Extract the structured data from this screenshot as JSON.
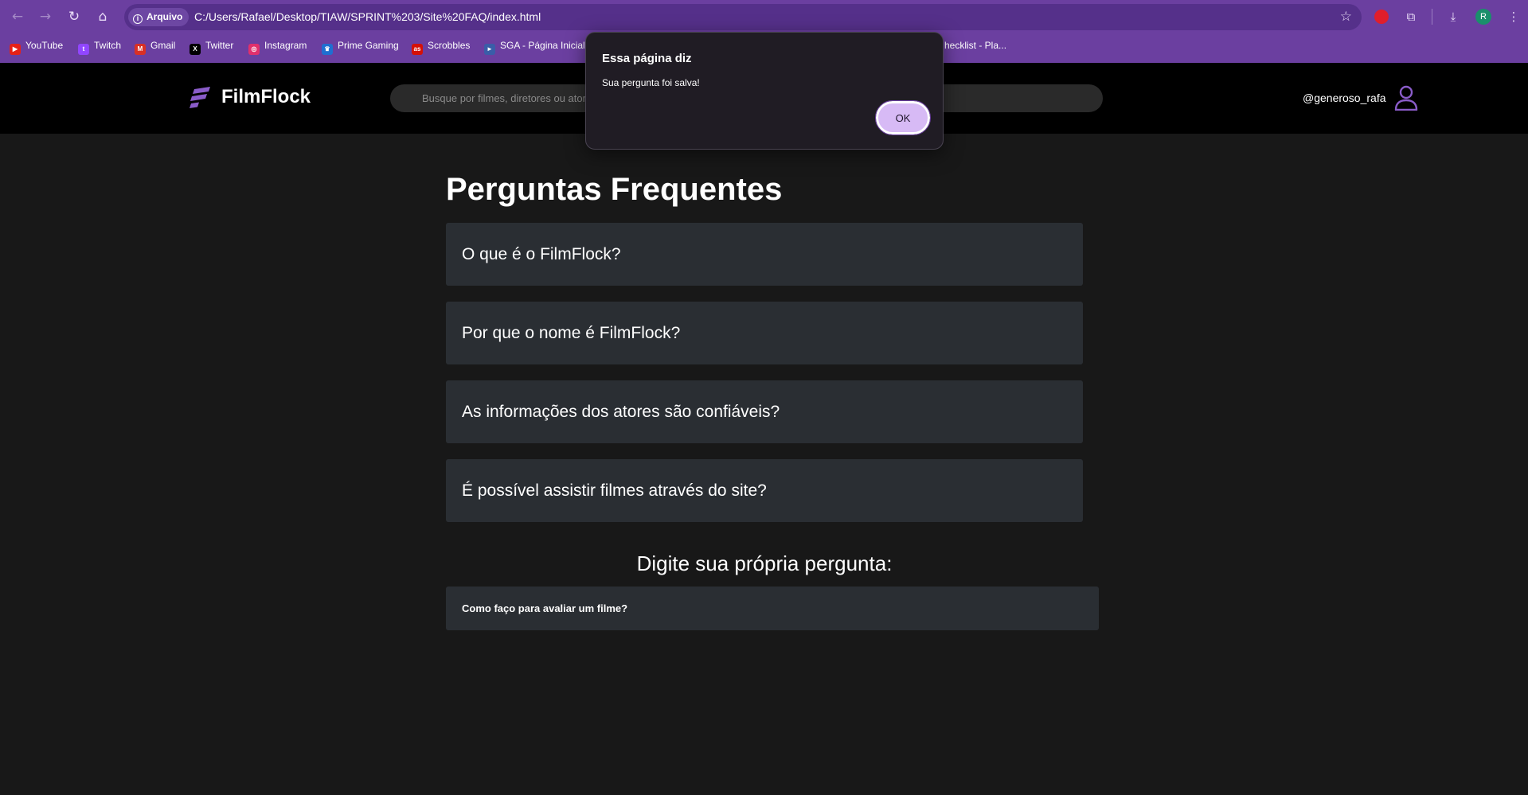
{
  "browser": {
    "nav_icons": {
      "back": "arrow-left-icon",
      "forward": "arrow-right-icon",
      "reload": "reload-icon",
      "home": "home-icon"
    },
    "security_chip": "Arquivo",
    "url": "C:/Users/Rafael/Desktop/TIAW/SPRINT%203/Site%20FAQ/index.html",
    "profile_initial": "R",
    "colors": {
      "frame": "#6b3fa0",
      "omnibox": "#55308a"
    }
  },
  "bookmarks": [
    {
      "label": "YouTube",
      "icon": "youtube-icon",
      "color": "#e62117"
    },
    {
      "label": "Twitch",
      "icon": "twitch-icon",
      "color": "#9146ff"
    },
    {
      "label": "Gmail",
      "icon": "gmail-icon",
      "color": "#d93025"
    },
    {
      "label": "Twitter",
      "icon": "x-icon",
      "color": "#000000"
    },
    {
      "label": "Instagram",
      "icon": "instagram-icon",
      "color": "#e1306c"
    },
    {
      "label": "Prime Gaming",
      "icon": "crown-icon",
      "color": "#1f6fd1"
    },
    {
      "label": "Scrobbles",
      "icon": "lastfm-icon",
      "color": "#d51007"
    },
    {
      "label": "SGA - Página Inicial",
      "icon": "sga-icon",
      "color": "#3a5da8"
    },
    {
      "label": "hecklist - Pla...",
      "icon": "",
      "color": ""
    }
  ],
  "site": {
    "brand": "FilmFlock",
    "search_placeholder": "Busque por filmes, diretores ou atores...",
    "username": "@generoso_rafa",
    "accent": "#8a5cc9"
  },
  "faq": {
    "title": "Perguntas Frequentes",
    "items": [
      "O que é o FilmFlock?",
      "Por que o nome é FilmFlock?",
      "As informações dos atores são confiáveis?",
      "É possível assistir filmes através do site?"
    ],
    "ask_title": "Digite sua própria pergunta:",
    "ask_value": "Como faço para avaliar um filme?"
  },
  "dialog": {
    "title": "Essa página diz",
    "message": "Sua pergunta foi salva!",
    "ok": "OK"
  }
}
